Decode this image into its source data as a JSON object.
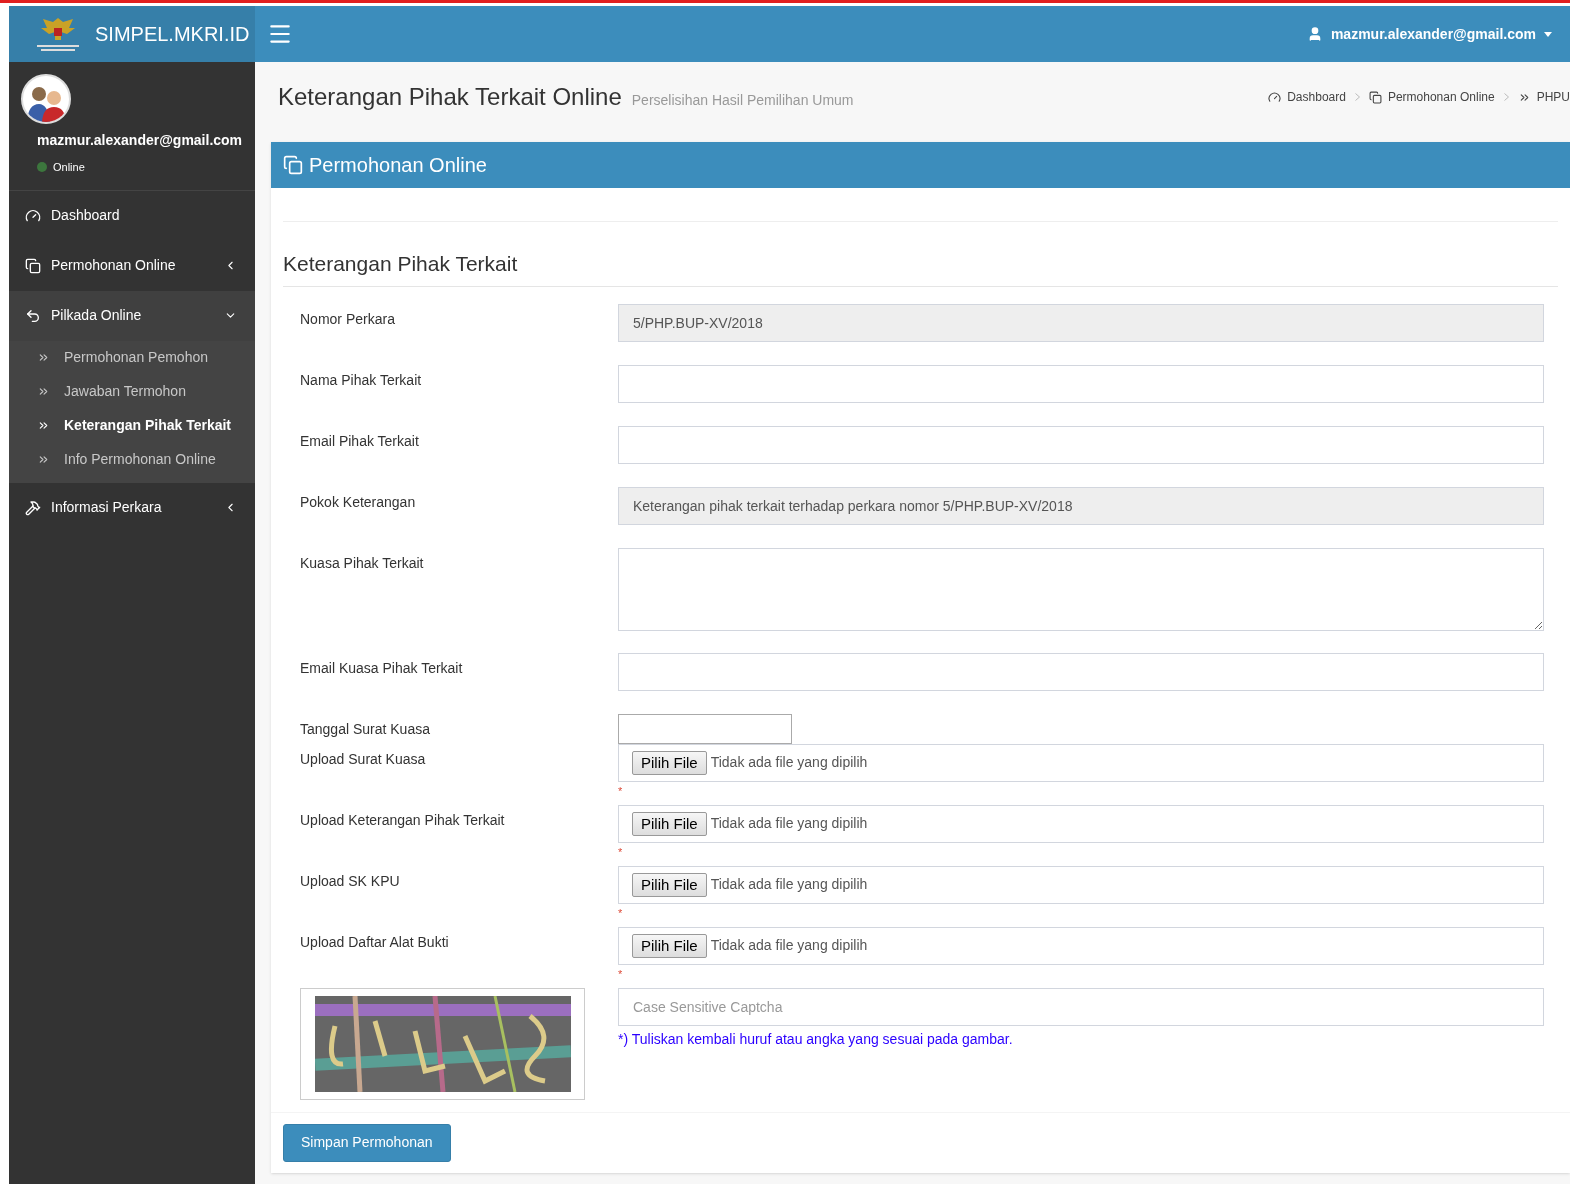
{
  "header": {
    "brand": "SIMPEL.MKRI.ID",
    "user": "mazmur.alexander@gmail.com"
  },
  "sidebar": {
    "email": "mazmur.alexander@gmail.com",
    "status": "Online",
    "items": [
      {
        "label": "Dashboard",
        "kind": "link",
        "expanded": false
      },
      {
        "label": "Permohonan Online",
        "kind": "menu",
        "expanded": false
      },
      {
        "label": "Pilkada Online",
        "kind": "menu",
        "expanded": true,
        "children": [
          {
            "label": "Permohonan Pemohon",
            "selected": false
          },
          {
            "label": "Jawaban Termohon",
            "selected": false
          },
          {
            "label": "Keterangan Pihak Terkait",
            "selected": true
          },
          {
            "label": "Info Permohonan Online",
            "selected": false
          }
        ]
      },
      {
        "label": "Informasi Perkara",
        "kind": "menu",
        "expanded": false
      }
    ]
  },
  "page": {
    "title": "Keterangan Pihak Terkait Online",
    "subtitle": "Perselisihan Hasil Pemilihan Umum",
    "breadcrumbs": [
      "Dashboard",
      "Permohonan Online",
      "PHPU"
    ]
  },
  "box": {
    "title": "Permohonan Online",
    "section": "Keterangan Pihak Terkait",
    "fields": [
      {
        "label": "Nomor Perkara",
        "kind": "text",
        "value": "5/PHP.BUP-XV/2018",
        "disabled": true
      },
      {
        "label": "Nama Pihak Terkait",
        "kind": "text",
        "disabled": false
      },
      {
        "label": "Email Pihak Terkait",
        "kind": "text",
        "disabled": false
      },
      {
        "label": "Pokok Keterangan",
        "kind": "text",
        "value": "Keterangan pihak terkait terhadap perkara nomor 5/PHP.BUP-XV/2018",
        "disabled": true
      },
      {
        "label": "Kuasa Pihak Terkait",
        "kind": "textarea",
        "disabled": false
      },
      {
        "label": "Email Kuasa Pihak Terkait",
        "kind": "text",
        "disabled": false
      },
      {
        "label": "Tanggal Surat Kuasa",
        "kind": "date",
        "disabled": false
      },
      {
        "label": "Upload Surat Kuasa",
        "kind": "file",
        "button": "Pilih File",
        "status": "Tidak ada file yang dipilih",
        "note": "*"
      },
      {
        "label": "Upload Keterangan Pihak Terkait",
        "kind": "file",
        "button": "Pilih File",
        "status": "Tidak ada file yang dipilih",
        "note": "*"
      },
      {
        "label": "Upload SK KPU",
        "kind": "file",
        "button": "Pilih File",
        "status": "Tidak ada file yang dipilih",
        "note": "*"
      },
      {
        "label": "Upload Daftar Alat Bukti",
        "kind": "file",
        "button": "Pilih File",
        "status": "Tidak ada file yang dipilih",
        "note": "*"
      }
    ],
    "captcha": {
      "placeholder": "Case Sensitive Captcha",
      "hint": "*) Tuliskan kembali huruf atau angka yang sesuai pada gambar."
    },
    "submit": "Simpan Permohonan"
  }
}
